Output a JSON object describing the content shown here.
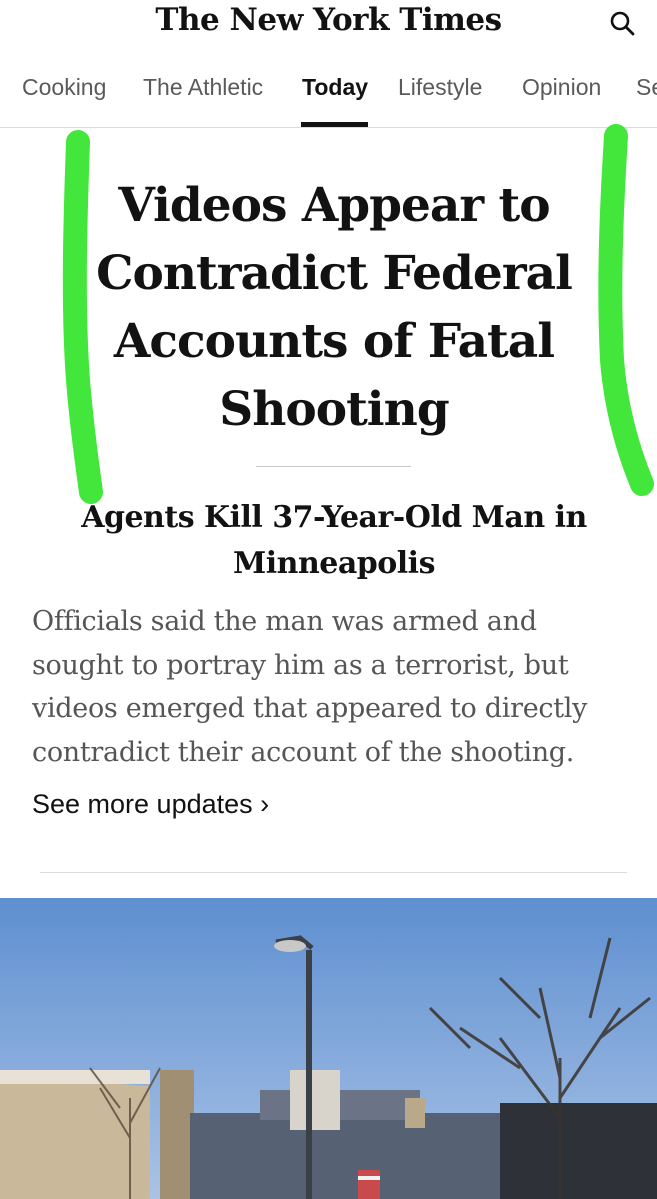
{
  "header": {
    "logo_text": "The New York Times",
    "search_icon": "search-icon"
  },
  "nav": {
    "tabs": [
      {
        "label": "Cooking"
      },
      {
        "label": "The Athletic"
      },
      {
        "label": "Today"
      },
      {
        "label": "Lifestyle"
      },
      {
        "label": "Opinion"
      },
      {
        "label": "Se"
      }
    ],
    "active": "Today"
  },
  "article": {
    "headline": "Videos Appear to Contradict Federal Accounts of Fatal Shooting",
    "subheadline": "Agents Kill 37-Year-Old Man in Minneapolis",
    "summary": "Officials said the man was armed and sought to portray him as a terrorist, but videos emerged that appeared to directly contradict their account of the shooting.",
    "more_link": "See more updates ›"
  },
  "annotation": {
    "marker_color": "#39e52f"
  },
  "colors": {
    "text": "#121212",
    "nav_inactive": "#5a5a5a",
    "summary": "#555555",
    "sky": "#6f9ad3"
  }
}
